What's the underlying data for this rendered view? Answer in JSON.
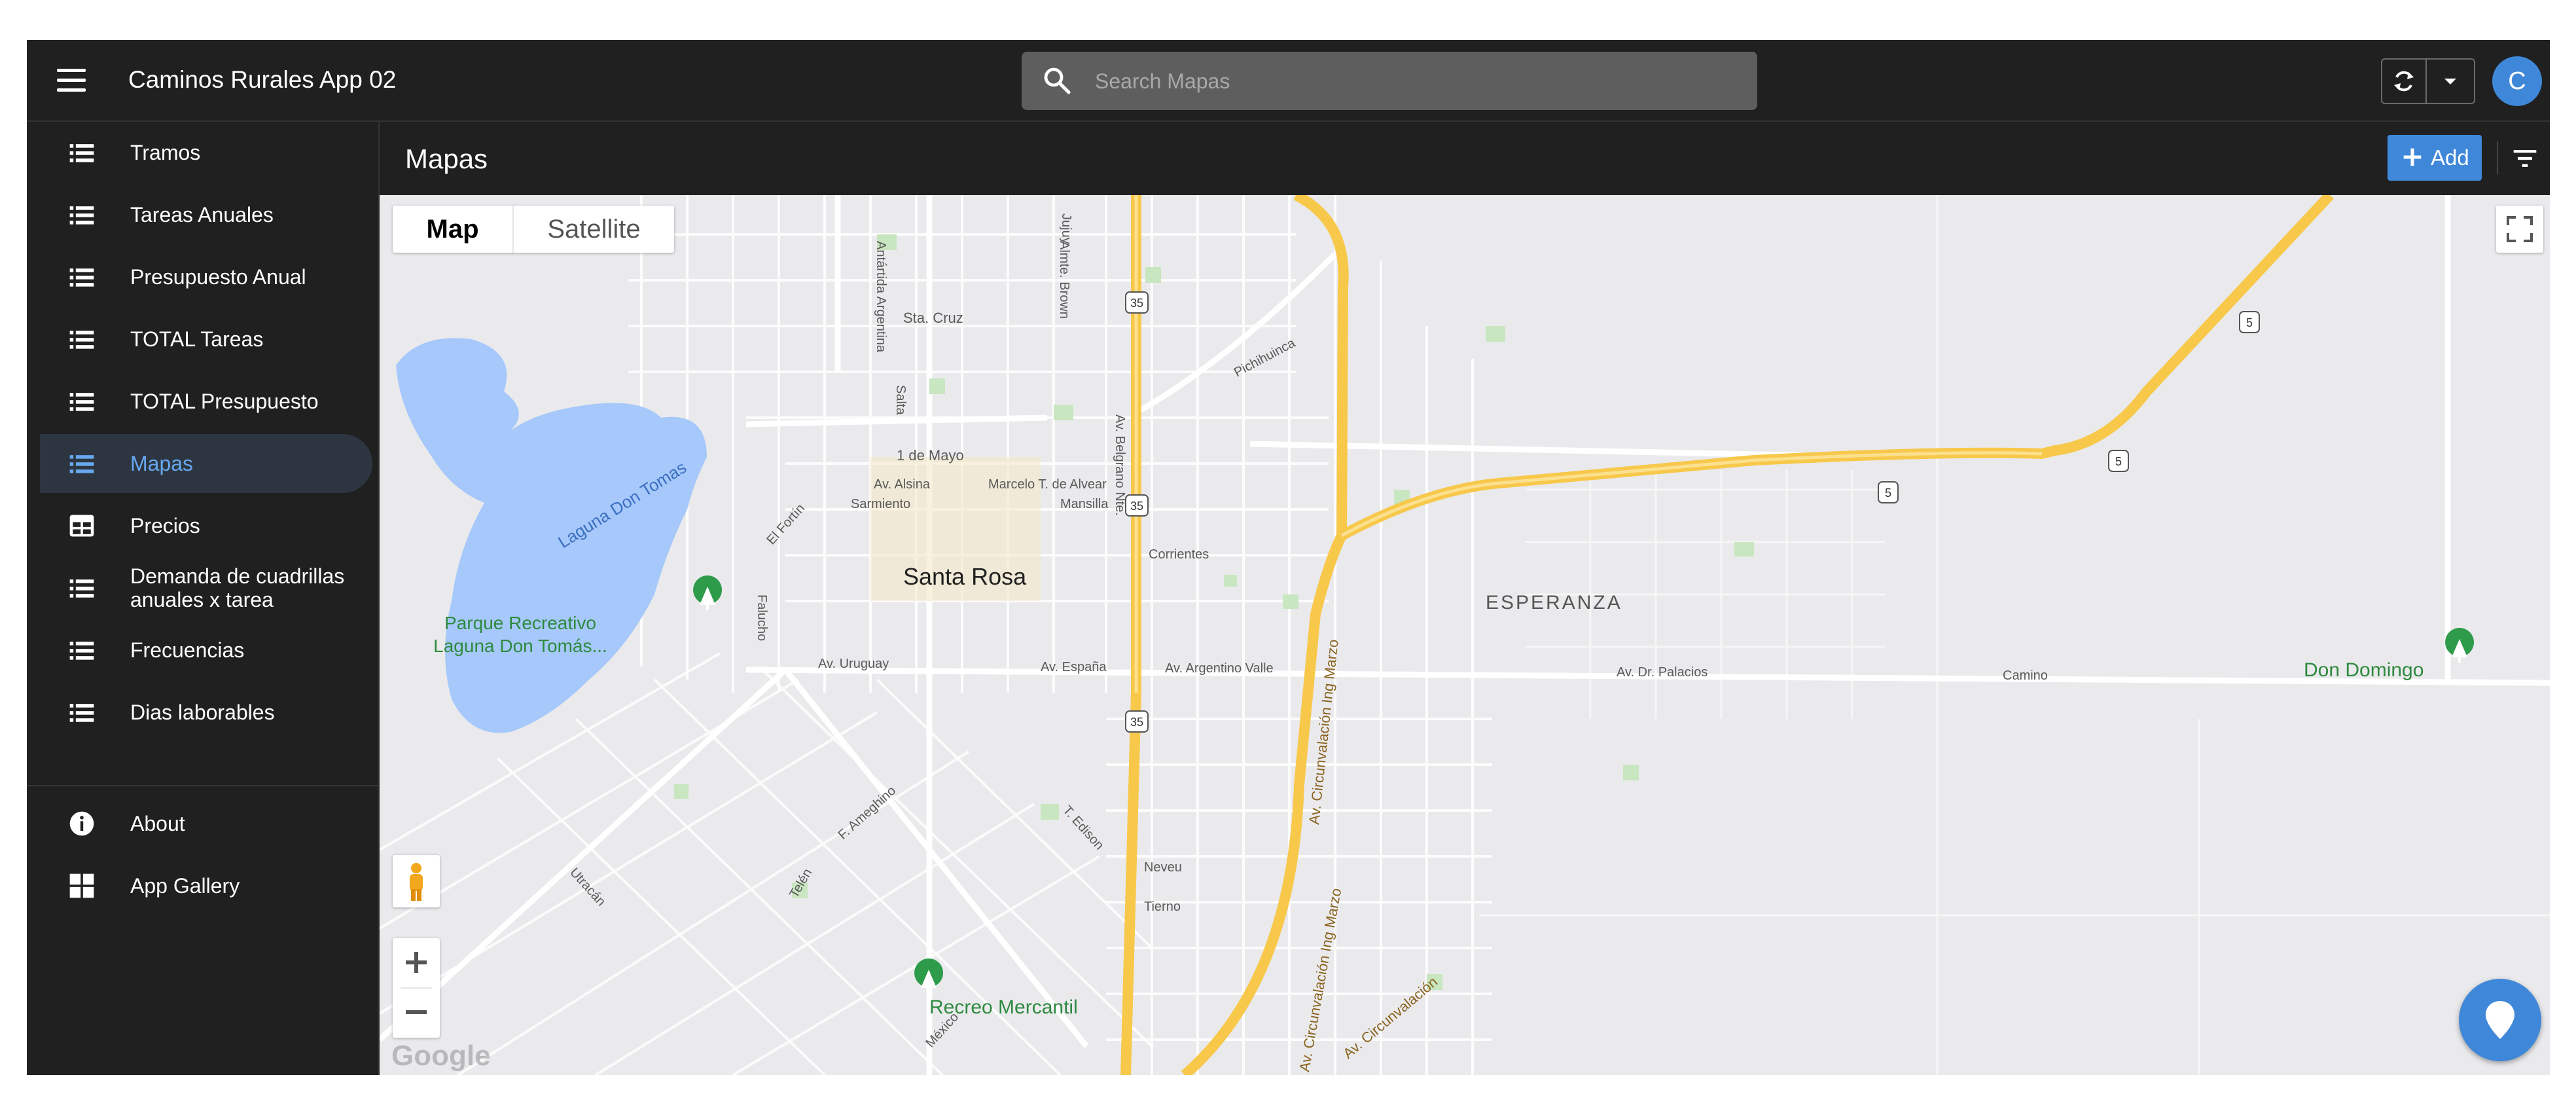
{
  "app": {
    "title": "Caminos Rurales App 02",
    "user_initial": "C"
  },
  "search": {
    "placeholder": "Search Mapas"
  },
  "sidebar": {
    "items": [
      {
        "label": "Tramos",
        "icon": "list-icon",
        "active": false
      },
      {
        "label": "Tareas Anuales",
        "icon": "list-icon",
        "active": false
      },
      {
        "label": "Presupuesto Anual",
        "icon": "list-icon",
        "active": false
      },
      {
        "label": "TOTAL Tareas",
        "icon": "list-icon",
        "active": false
      },
      {
        "label": "TOTAL Presupuesto",
        "icon": "list-icon",
        "active": false
      },
      {
        "label": "Mapas",
        "icon": "list-icon",
        "active": true
      },
      {
        "label": "Precios",
        "icon": "table-icon",
        "active": false
      },
      {
        "label": "Demanda de cuadrillas anuales x tarea",
        "icon": "list-icon",
        "active": false
      },
      {
        "label": "Frecuencias",
        "icon": "list-icon",
        "active": false
      },
      {
        "label": "Dias laborables",
        "icon": "list-icon",
        "active": false
      }
    ],
    "footer": [
      {
        "label": "About",
        "icon": "info-icon"
      },
      {
        "label": "App Gallery",
        "icon": "grid-icon"
      }
    ]
  },
  "page": {
    "title": "Mapas",
    "add_label": "Add"
  },
  "map": {
    "type_options": [
      "Map",
      "Satellite"
    ],
    "selected_type": "Map",
    "labels": {
      "city": "Santa Rosa",
      "esperanza": "ESPERANZA",
      "park1_line1": "Parque Recreativo",
      "park1_line2": "Laguna Don Tomás...",
      "park2": "Recreo Mercantil",
      "park3": "Don Domingo",
      "lake": "Laguna Don Tomas",
      "st_cruz": "Sta. Cruz",
      "mayo": "1 de Mayo",
      "alsina": "Av. Alsina",
      "alvear": "Marcelo T. de Alvear",
      "sarmiento": "Sarmiento",
      "mansilla": "Mansilla",
      "corrientes": "Corrientes",
      "uruguay": "Av. Uruguay",
      "espana": "Av. España",
      "argentino_valle": "Av. Argentino Valle",
      "palacios": "Av. Dr. Palacios",
      "camino": "Camino",
      "neveu": "Neveu",
      "tierno": "Tierno",
      "pichihuinca": "Pichihuinca",
      "belgrano": "Av. Belgrano Nte.",
      "almte_brown": "Almte. Brown",
      "antartida": "Antártida Argentina",
      "salta": "Salta",
      "fortin": "El Fortín",
      "falucho": "Falucho",
      "circunvalacion": "Av. Circunvalación Ing Marzo",
      "circunvalacion2": "Av. Circunvalación Ing Marzo",
      "circunvalacion3": "Av. Circunvalación",
      "ameghino": "F. Ameghino",
      "edison": "T. Edison",
      "telen": "Telén",
      "utracan": "Utracán",
      "mexico": "México",
      "jujuy": "Jujuy",
      "google": "Google"
    },
    "route_shields": [
      "35",
      "35",
      "35",
      "5",
      "5",
      "5"
    ]
  },
  "colors": {
    "bar": "#202020",
    "accent": "#3f88d9",
    "active_text": "#67a8f0",
    "map_bg": "#eaeaed",
    "water": "#a6c8fa",
    "highway": "#f7c84a",
    "park": "#2e8a3f"
  }
}
